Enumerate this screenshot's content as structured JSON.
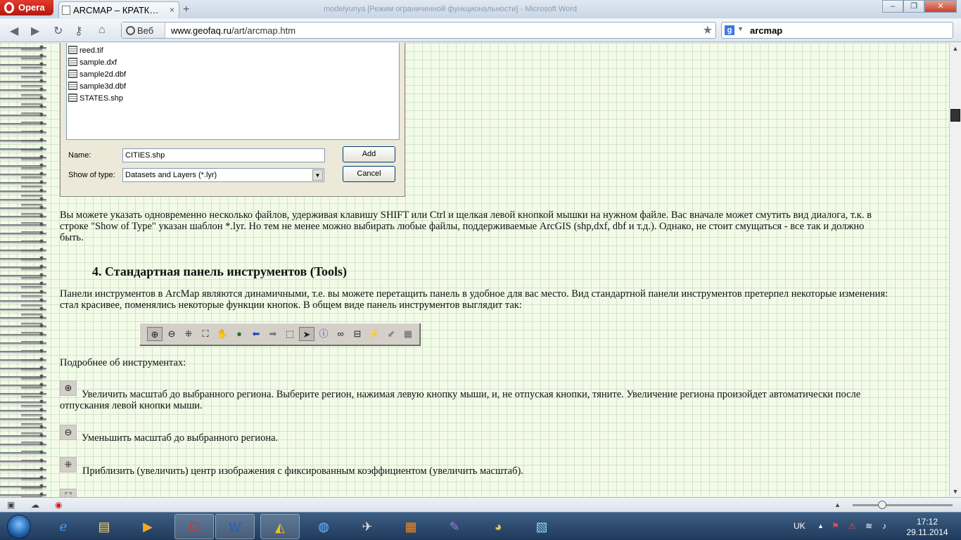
{
  "browser": {
    "menu_label": "Opera",
    "tab_title": "ARCMAP – КРАТК…",
    "tab_close": "×",
    "new_tab": "+",
    "window_title": "modelyunya [Режим ограниченной функциональности] - Microsoft Word",
    "address_prefix": "Веб",
    "url_host": "www.geofaq.ru",
    "url_path": "/art/arcmap.htm",
    "search_query": "arcmap",
    "window_controls": {
      "minimize": "‒",
      "maximize": "❐",
      "close": "✕"
    }
  },
  "dialog": {
    "files": [
      "reed.tif",
      "sample.dxf",
      "sample2d.dbf",
      "sample3d.dbf",
      "STATES.shp"
    ],
    "name_label": "Name:",
    "name_value": "CITIES.shp",
    "type_label": "Show of type:",
    "type_value": "Datasets and Layers (*.lyr)",
    "add_button": "Add",
    "cancel_button": "Cancel"
  },
  "content": {
    "para1": "Вы можете указать одновременно несколько файлов, удерживая клавишу SHIFT или Ctrl и щелкая левой кнопкой мышки на нужном файле. Вас вначале может смутить вид диалога, т.к. в строке \"Show of Type\" указан шаблон *.lyr. Но тем не менее можно выбирать любые файлы, поддерживаемые ArcGIS (shp,dxf, dbf и т.д.). Однако, не стоит смущаться - все так и должно быть.",
    "heading": "4. Стандартная панель инструментов (Tools)",
    "para2": "Панели инструментов в ArcMap являются динамичными, т.е. вы можете перетащить панель в удобное для вас место. Вид стандартной панели инструментов претерпел некоторые изменения: стал красивее, поменялись некоторые функции кнопок. В общем виде панель инструментов выглядит так:",
    "more_label": "Подробнее об инструментах:",
    "tool1": "Увеличить масштаб до выбранного региона. Выберите регион, нажимая левую кнопку мыши, и, не отпуская кнопки, тяните. Увеличение региона произойдет автоматически после отпускания левой кнопки мыши.",
    "tool2": "Уменьшить масштаб до выбранного региона.",
    "tool3": "Приблизить (увеличить) центр изображения с фиксированным коэффициентом (увеличить масштаб)."
  },
  "toolbar_icons": [
    "zoom-in-icon",
    "zoom-out-icon",
    "fixed-zoom-in-icon",
    "fixed-zoom-out-icon",
    "pan-hand-icon",
    "full-extent-globe-icon",
    "back-arrow-icon",
    "forward-arrow-icon",
    "select-features-icon",
    "select-pointer-icon",
    "identify-icon",
    "find-binoculars-icon",
    "measure-icon",
    "hyperlink-lightning-icon",
    "go-to-xy-icon",
    "grid-icon"
  ],
  "taskbar": {
    "language": "UK",
    "time": "17:12",
    "date": "29.11.2014"
  },
  "colors": {
    "page_background": "#f3fbe8",
    "taskbar": "#1f3a5c",
    "opera_red": "#c8251a"
  }
}
